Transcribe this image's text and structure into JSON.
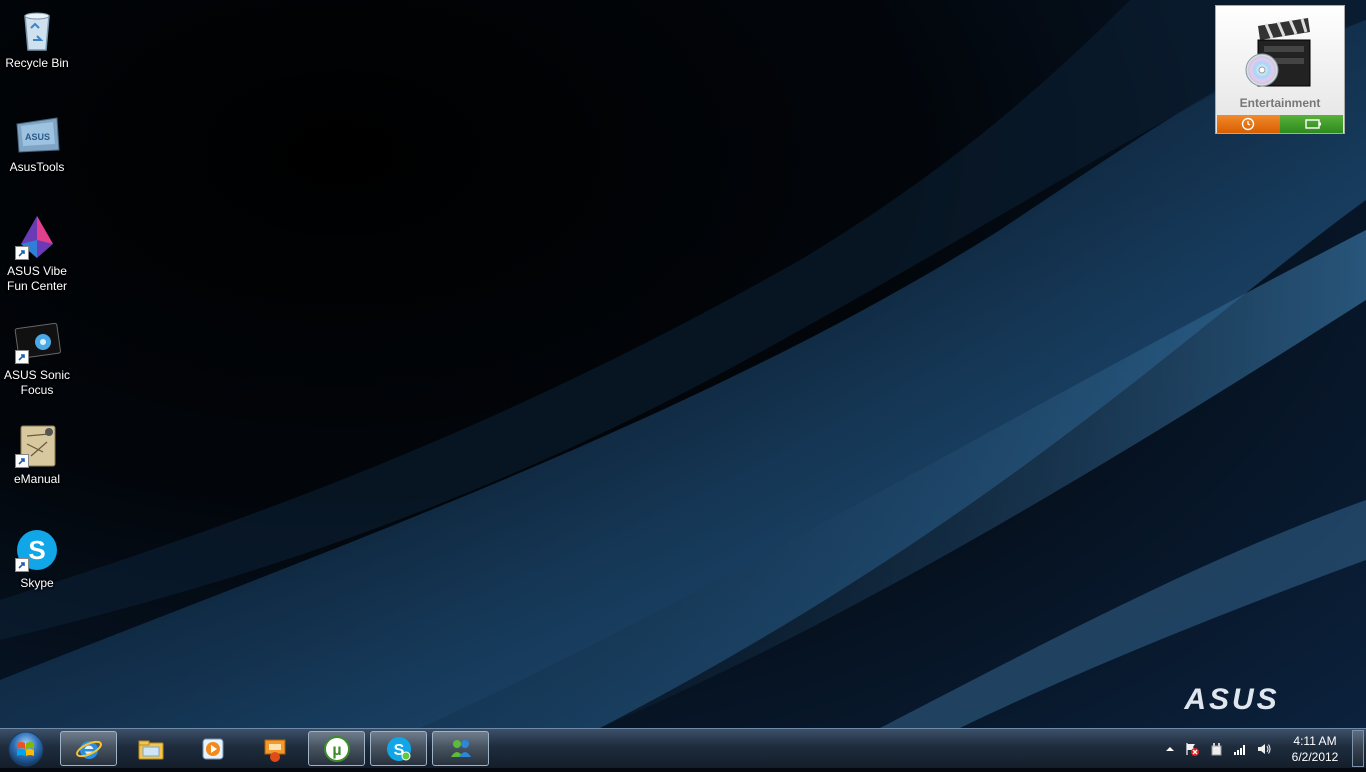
{
  "desktop": {
    "icons": [
      {
        "label": "Recycle Bin"
      },
      {
        "label": "AsusTools"
      },
      {
        "label": "ASUS  Vibe Fun Center"
      },
      {
        "label": "ASUS Sonic Focus"
      },
      {
        "label": "eManual"
      },
      {
        "label": "Skype"
      }
    ],
    "logo_text": "ASUS"
  },
  "gadget": {
    "title": "Entertainment"
  },
  "taskbar": {
    "pinned": [
      "internet-explorer-icon",
      "file-explorer-icon",
      "media-player-icon",
      "media-center-icon",
      "utorrent-icon",
      "skype-icon",
      "messenger-icon"
    ],
    "clock": {
      "time": "4:11 AM",
      "date": "6/2/2012"
    }
  },
  "colors": {
    "taskbar": "#1e2c3d",
    "gadget_orange": "#e8731a",
    "gadget_green": "#43a12c"
  }
}
